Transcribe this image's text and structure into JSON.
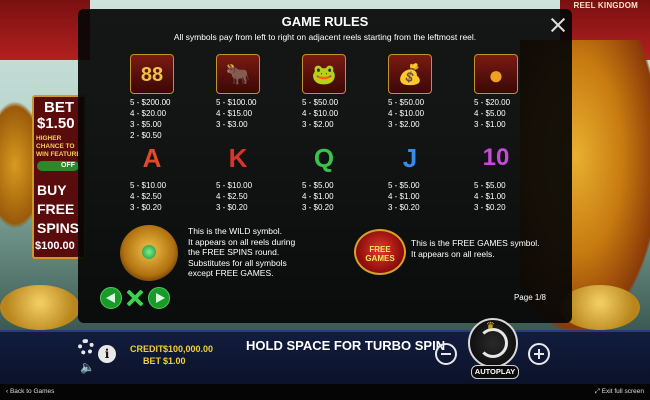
{
  "brand": "REEL KINGDOM",
  "side_panel": {
    "bet_label": "BET",
    "bet_value": "$1.50",
    "higher_chance": "HIGHER\nCHANCE TO\nWIN FEATURE",
    "toggle": "OFF",
    "buy_label": "BUY\nFREE\nSPINS",
    "buy_cost": "$100.00"
  },
  "modal": {
    "title": "GAME RULES",
    "subtitle": "All symbols pay from left to right on adjacent reels starting from the leftmost reel.",
    "row1": [
      {
        "icon": "eighty-eight-icon",
        "glyph": "88",
        "pays": "5 - $200.00\n4 - $20.00\n3 - $5.00\n2 - $0.50"
      },
      {
        "icon": "golden-ox-icon",
        "glyph": "🐂",
        "pays": "5 - $100.00\n4 - $15.00\n3 - $3.00"
      },
      {
        "icon": "golden-toad-icon",
        "glyph": "🐸",
        "pays": "5 - $50.00\n4 - $10.00\n3 - $2.00"
      },
      {
        "icon": "gold-ingot-icon",
        "glyph": "💰",
        "pays": "5 - $50.00\n4 - $10.00\n3 - $2.00"
      },
      {
        "icon": "dragon-pearl-icon",
        "glyph": "●",
        "pays": "5 - $20.00\n4 - $5.00\n3 - $1.00"
      }
    ],
    "row2": [
      {
        "icon": "letter-a-icon",
        "glyph": "A",
        "color": "#e24a2a",
        "pays": "5 - $10.00\n4 - $2.50\n3 - $0.20"
      },
      {
        "icon": "letter-k-icon",
        "glyph": "K",
        "color": "#d8342a",
        "pays": "5 - $10.00\n4 - $2.50\n3 - $0.20"
      },
      {
        "icon": "letter-q-icon",
        "glyph": "Q",
        "color": "#3ac24a",
        "pays": "5 - $5.00\n4 - $1.00\n3 - $0.20"
      },
      {
        "icon": "letter-j-icon",
        "glyph": "J",
        "color": "#3a8ae8",
        "pays": "5 - $5.00\n4 - $1.00\n3 - $0.20"
      },
      {
        "icon": "ten-icon",
        "glyph": "10",
        "color": "#c84ad8",
        "pays": "5 - $5.00\n4 - $1.00\n3 - $0.20"
      }
    ],
    "wild_text": "This is the WILD symbol.\nIt appears on all reels during\nthe FREE SPINS round.\nSubstitutes for all symbols\nexcept FREE GAMES.",
    "free_icon_text": "FREE\nGAMES",
    "free_text": "This is the FREE GAMES symbol.\nIt appears on all reels.",
    "page": "Page 1/8"
  },
  "bar": {
    "credit_label": "CREDIT",
    "credit_value": "$100,000.00",
    "bet_label": "BET",
    "bet_value": "$1.00",
    "message": "HOLD SPACE FOR TURBO SPIN",
    "autoplay": "AUTOPLAY"
  },
  "footer": {
    "back": "‹ Back to Games",
    "fullscreen": "⤢ Exit full screen"
  }
}
